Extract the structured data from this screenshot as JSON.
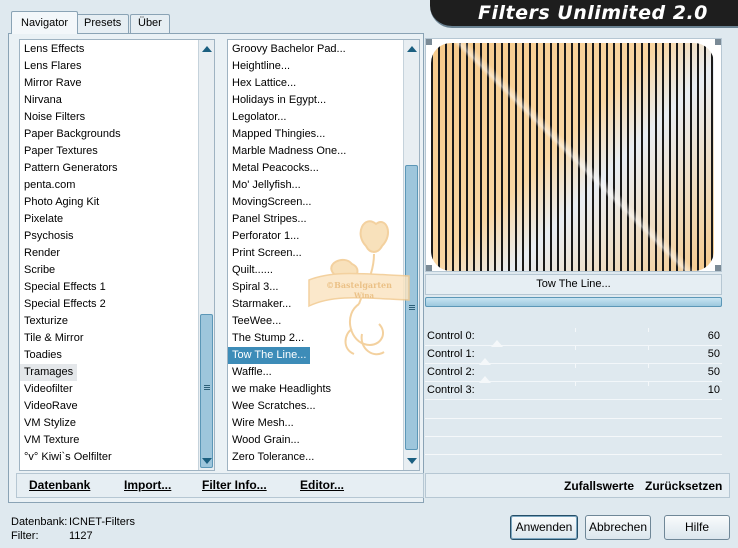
{
  "window_title": "Filters Unlimited 2.0",
  "tabs": [
    {
      "label": "Navigator",
      "active": true
    },
    {
      "label": "Presets",
      "active": false
    },
    {
      "label": "Über",
      "active": false
    }
  ],
  "categories": [
    "Lens Effects",
    "Lens Flares",
    "Mirror Rave",
    "Nirvana",
    "Noise Filters",
    "Paper Backgrounds",
    "Paper Textures",
    "Pattern Generators",
    "penta.com",
    "Photo Aging Kit",
    "Pixelate",
    "Psychosis",
    "Render",
    "Scribe",
    "Special Effects 1",
    "Special Effects 2",
    "Texturize",
    "Tile & Mirror",
    "Toadies",
    "Tramages",
    "Videofilter",
    "VideoRave",
    "VM Stylize",
    "VM Texture",
    "°v° Kiwi`s Oelfilter"
  ],
  "selected_category": "Tramages",
  "filters": [
    "Groovy Bachelor Pad...",
    "Heightline...",
    "Hex Lattice...",
    "Holidays in Egypt...",
    "Legolator...",
    "Mapped Thingies...",
    "Marble Madness One...",
    "Metal Peacocks...",
    "Mo' Jellyfish...",
    "MovingScreen...",
    "Panel Stripes...",
    "Perforator 1...",
    "Print Screen...",
    "Quilt......",
    "Spiral 3...",
    "Starmaker...",
    "TeeWee...",
    "The Stump 2...",
    "Tow The Line...",
    "Waffle...",
    "we make Headlights",
    "Wee Scratches...",
    "Wire Mesh...",
    "Wood Grain...",
    "Zero Tolerance..."
  ],
  "selected_filter": "Tow The Line...",
  "watermark_text": [
    "©Bastelgarten",
    "Wina"
  ],
  "left_buttons": {
    "database": "Datenbank",
    "import": "Import...",
    "filter_info": "Filter Info...",
    "editor": "Editor..."
  },
  "filter_name": "Tow The Line...",
  "controls": [
    {
      "label": "Control 0:",
      "value": "60"
    },
    {
      "label": "Control 1:",
      "value": "50"
    },
    {
      "label": "Control 2:",
      "value": "50"
    },
    {
      "label": "Control 3:",
      "value": "10"
    }
  ],
  "right_buttons": {
    "randomize": "Zufallswerte",
    "reset": "Zurücksetzen"
  },
  "status": {
    "database_label": "Datenbank:",
    "database_value": "ICNET-Filters",
    "filter_label": "Filter:",
    "filter_value": "1127"
  },
  "footer_buttons": {
    "apply": "Anwenden",
    "cancel": "Abbrechen",
    "help": "Hilfe"
  },
  "colors": {
    "accent": "#3d8cb8",
    "preview_peach": "#f5c98a",
    "banner": "#1e1e1e"
  }
}
